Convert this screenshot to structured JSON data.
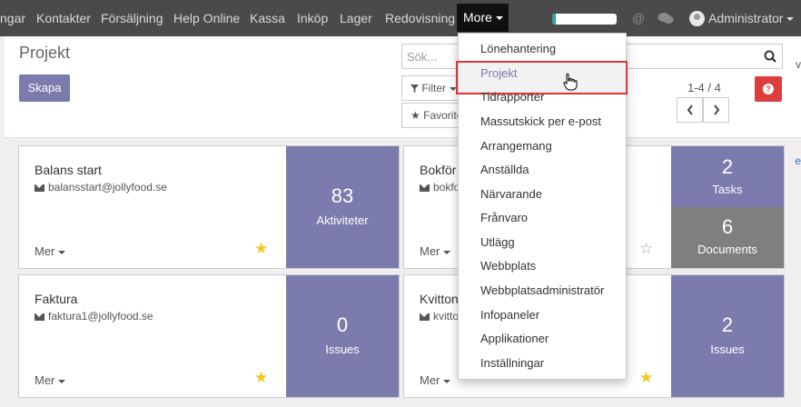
{
  "navbar": {
    "items": [
      "ngar",
      "Kontakter",
      "Försäljning",
      "Help Online",
      "Kassa",
      "Inköp",
      "Lager",
      "Redovisning"
    ],
    "more_label": "More",
    "progress": 0.06,
    "user_label": "Administrator",
    "at_icon": "@",
    "chat_icon": "chat-bubbles-icon"
  },
  "control": {
    "title": "Projekt",
    "create_label": "Skapa",
    "search_placeholder": "Sök...",
    "filter_label": "Filter",
    "favorites_label": "Favorite",
    "pager_value": "1-4 / 4",
    "edge_letters": [
      "v",
      "e"
    ]
  },
  "cards": [
    {
      "name": "Balans start",
      "email": "balansstart@jollyfood.se",
      "more": "Mer",
      "starred": true,
      "stats": [
        {
          "value": "83",
          "label": "Aktiviteter"
        }
      ]
    },
    {
      "name": "Bokför",
      "email": "bokfo",
      "more": "Mer",
      "starred": false,
      "stats": [
        {
          "value": "2",
          "label": "Tasks"
        },
        {
          "value": "6",
          "label": "Documents"
        }
      ]
    },
    {
      "name": "Faktura",
      "email": "faktura1@jollyfood.se",
      "more": "Mer",
      "starred": true,
      "stats": [
        {
          "value": "0",
          "label": "Issues"
        }
      ]
    },
    {
      "name": "Kvitton",
      "email": "kvitto",
      "more": "Mer",
      "starred": true,
      "stats": [
        {
          "value": "2",
          "label": "Issues"
        }
      ]
    }
  ],
  "dropdown": {
    "items": [
      "Lönehantering",
      "Projekt",
      "Tidrapporter",
      "Massutskick per e-post",
      "Arrangemang",
      "Anställda",
      "Närvarande",
      "Frånvaro",
      "Utlägg",
      "Webbplats",
      "Webbplatsadministratör",
      "Infopaneler",
      "Applikationer",
      "Inställningar"
    ],
    "active": "Projekt"
  },
  "colors": {
    "navbar": "#4a4a4a",
    "accent": "#7c7bad",
    "documents_stat": "#7f7f7f",
    "star_on": "#f5c518",
    "star_off": "#aaaaaa",
    "help": "#dc3e3e",
    "highlight_box": "#e03333"
  }
}
